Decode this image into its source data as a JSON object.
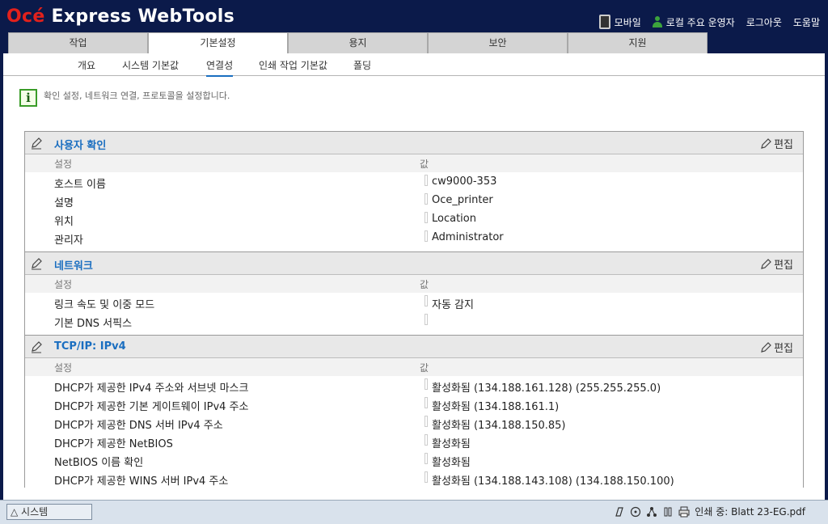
{
  "header": {
    "logo_brand": "Océ",
    "logo_rest": " Express WebTools",
    "mobile": "모바일",
    "local_operator": "로컬 주요 운영자",
    "logout": "로그아웃",
    "help": "도움말"
  },
  "tabs": [
    "작업",
    "기본설정",
    "용지",
    "보안",
    "지원"
  ],
  "subtabs": [
    "개요",
    "시스템 기본값",
    "연결성",
    "인쇄 작업 기본값",
    "폴딩"
  ],
  "info_text": "확인 설정, 네트워크 연결, 프로토콜을 설정합니다.",
  "col_setting": "설정",
  "col_value": "값",
  "edit_label": "편집",
  "sections": [
    {
      "title": "사용자 확인",
      "rows": [
        {
          "k": "호스트 이름",
          "v": "cw9000-353"
        },
        {
          "k": "설명",
          "v": "Oce_printer"
        },
        {
          "k": "위치",
          "v": "Location"
        },
        {
          "k": "관리자",
          "v": "Administrator"
        }
      ]
    },
    {
      "title": "네트워크",
      "rows": [
        {
          "k": "링크 속도 및 이중 모드",
          "v": "자동 감지"
        },
        {
          "k": "기본 DNS 서픽스",
          "v": ""
        }
      ]
    },
    {
      "title": "TCP/IP: IPv4",
      "rows": [
        {
          "k": "DHCP가 제공한 IPv4 주소와 서브넷 마스크",
          "v": "활성화됨 (134.188.161.128) (255.255.255.0)"
        },
        {
          "k": "DHCP가 제공한 기본 게이트웨이 IPv4 주소",
          "v": "활성화됨 (134.188.161.1)"
        },
        {
          "k": "DHCP가 제공한 DNS 서버 IPv4 주소",
          "v": "활성화됨 (134.188.150.85)"
        },
        {
          "k": "DHCP가 제공한 NetBIOS",
          "v": "활성화됨"
        },
        {
          "k": "NetBIOS 이름 확인",
          "v": "활성화됨"
        },
        {
          "k": "DHCP가 제공한 WINS 서버 IPv4 주소",
          "v": "활성화됨 (134.188.143.108) (134.188.150.100)"
        }
      ]
    }
  ],
  "statusbar": {
    "system_tab": "△ 시스템",
    "printing": "인쇄 중: Blatt 23-EG.pdf"
  }
}
